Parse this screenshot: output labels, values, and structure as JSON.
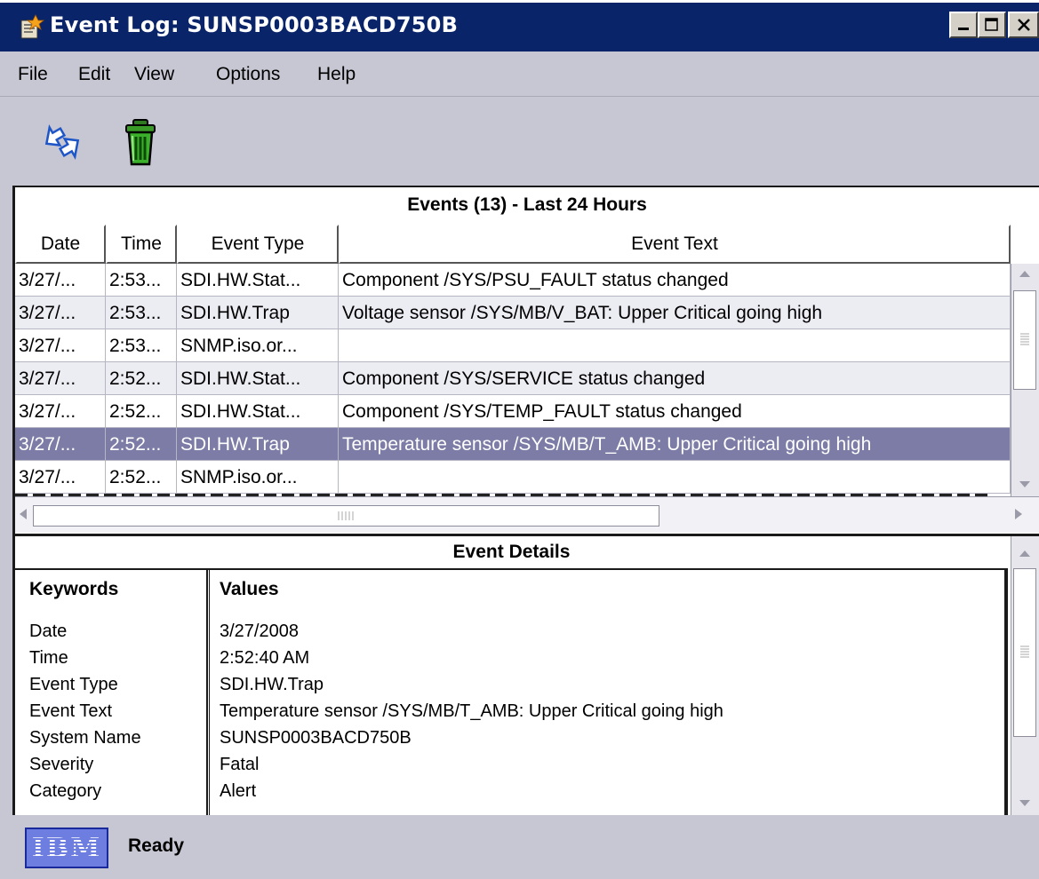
{
  "window": {
    "title": "Event Log: SUNSP0003BACD750B"
  },
  "menu": {
    "items": [
      "File",
      "Edit",
      "View",
      "Options",
      "Help"
    ]
  },
  "toolbar": {
    "buttons": [
      {
        "icon": "refresh-arrows-icon"
      },
      {
        "icon": "trash-can-icon"
      }
    ]
  },
  "events": {
    "title": "Events (13)  -  Last 24 Hours",
    "columns": [
      "Date",
      "Time",
      "Event Type",
      "Event Text"
    ],
    "rows": [
      {
        "date": "3/27/...",
        "time": "2:53...",
        "type": "SDI.HW.Stat...",
        "text": "Component /SYS/PSU_FAULT status changed"
      },
      {
        "date": "3/27/...",
        "time": "2:53...",
        "type": "SDI.HW.Trap",
        "text": "Voltage sensor /SYS/MB/V_BAT: Upper Critical going high"
      },
      {
        "date": "3/27/...",
        "time": "2:53...",
        "type": "SNMP.iso.or...",
        "text": ""
      },
      {
        "date": "3/27/...",
        "time": "2:52...",
        "type": "SDI.HW.Stat...",
        "text": "Component /SYS/SERVICE status changed"
      },
      {
        "date": "3/27/...",
        "time": "2:52...",
        "type": "SDI.HW.Stat...",
        "text": "Component /SYS/TEMP_FAULT status changed"
      },
      {
        "date": "3/27/...",
        "time": "2:52...",
        "type": "SDI.HW.Trap",
        "text": "Temperature sensor /SYS/MB/T_AMB: Upper Critical going high"
      },
      {
        "date": "3/27/...",
        "time": "2:52...",
        "type": "SNMP.iso.or...",
        "text": ""
      }
    ],
    "selected_row": 5
  },
  "details": {
    "title": "Event Details",
    "keywords_header": "Keywords",
    "values_header": "Values",
    "rows": [
      {
        "key": "Date",
        "value": "3/27/2008"
      },
      {
        "key": "Time",
        "value": "2:52:40 AM"
      },
      {
        "key": "Event Type",
        "value": "SDI.HW.Trap"
      },
      {
        "key": "Event Text",
        "value": "Temperature sensor /SYS/MB/T_AMB: Upper Critical going high"
      },
      {
        "key": "System Name",
        "value": "SUNSP0003BACD750B"
      },
      {
        "key": "Severity",
        "value": "Fatal"
      },
      {
        "key": "Category",
        "value": "Alert"
      }
    ]
  },
  "status": {
    "logo_text": "IBM",
    "text": "Ready"
  },
  "colors": {
    "titlebar": "#0a246a",
    "selected_row": "#7c7ca6",
    "chrome": "#c6c7d3"
  }
}
